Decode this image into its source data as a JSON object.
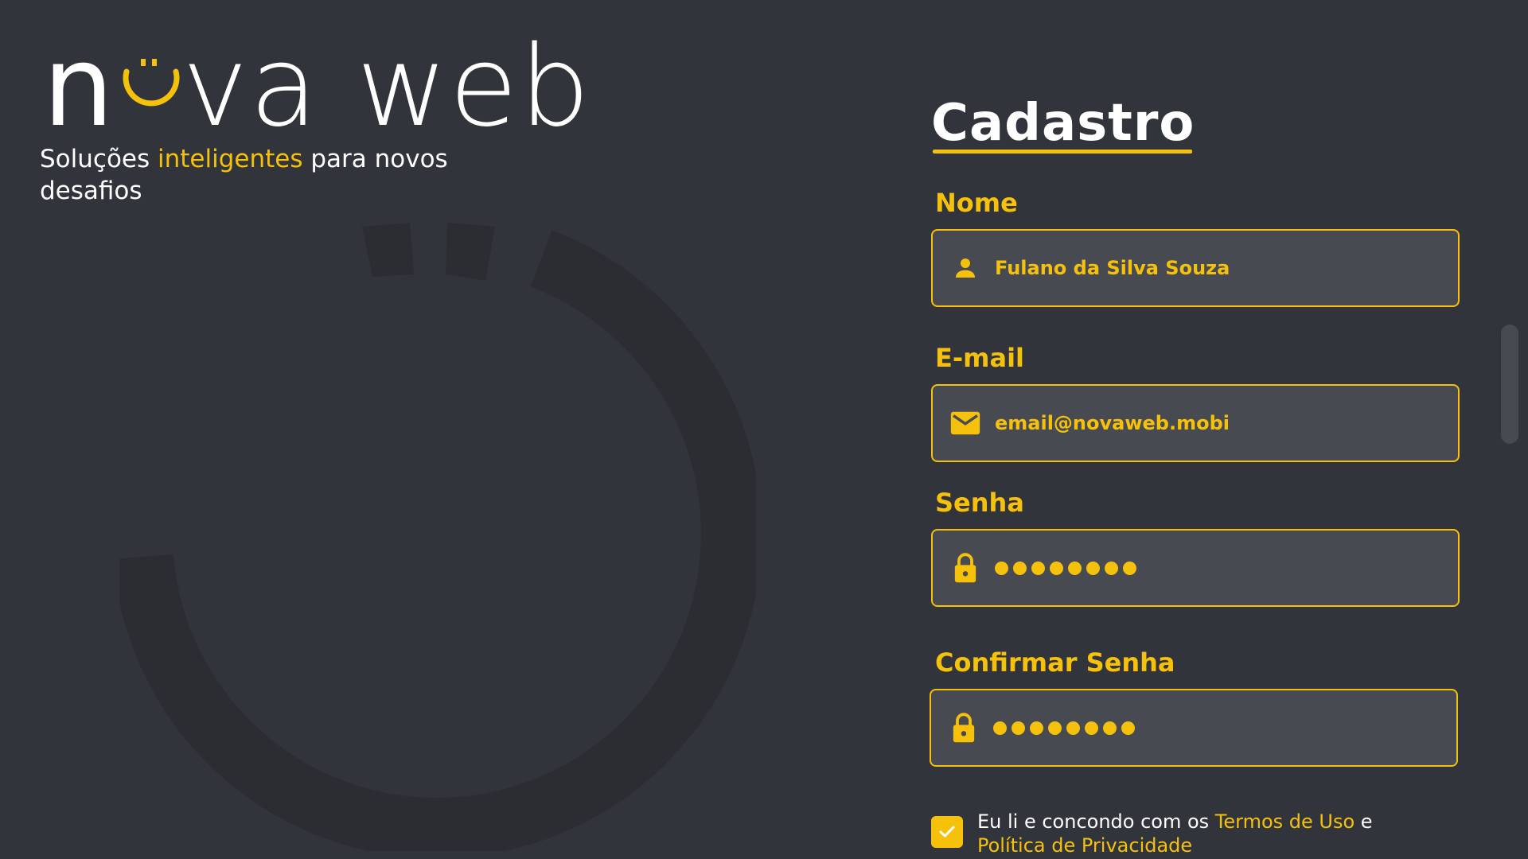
{
  "brand": {
    "logo_part1": "n",
    "logo_part2": "va web",
    "tagline_prefix": "Soluções ",
    "tagline_accent": "inteligentes",
    "tagline_suffix": " para novos desafios",
    "accent_color": "#f5c10b",
    "background_color": "#32343c"
  },
  "form": {
    "title": "Cadastro",
    "fields": {
      "name": {
        "label": "Nome",
        "value": "Fulano da Silva Souza",
        "icon": "user-icon"
      },
      "email": {
        "label": "E-mail",
        "value": "email@novaweb.mobi",
        "icon": "mail-icon"
      },
      "password": {
        "label": "Senha",
        "masked_value": "••••••••",
        "icon": "lock-icon"
      },
      "confirm_password": {
        "label": "Confirmar Senha",
        "masked_value": "••••••••",
        "icon": "lock-icon"
      }
    },
    "terms": {
      "checked": true,
      "text_prefix": "Eu li e concondo com os ",
      "terms_link": "Termos de Uso",
      "text_middle": " e ",
      "privacy_link": "Política de Privacidade"
    }
  }
}
